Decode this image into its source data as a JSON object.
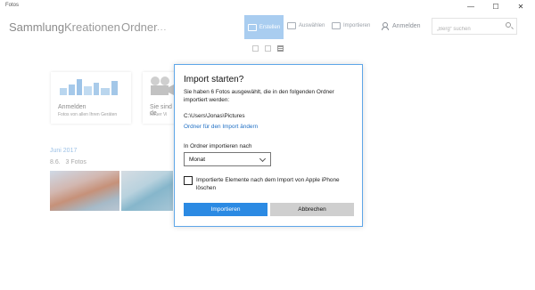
{
  "window": {
    "title": "Fotos",
    "min_glyph": "—",
    "max_glyph": "☐",
    "close_glyph": "✕"
  },
  "nav": {
    "tabs": [
      "Sammlung",
      "Kreationen",
      "Ordner"
    ],
    "more": "..."
  },
  "toolbar": {
    "erstellen": "Erstellen",
    "auswaehlen": "Auswählen",
    "importieren": "Importieren",
    "anmelden": "Anmelden"
  },
  "search": {
    "placeholder": "„Berg“ suchen"
  },
  "cards": [
    {
      "title": "Anmelden",
      "subtitle": "Fotos von allen Ihren Geräten"
    },
    {
      "title": "Sie sind de",
      "subtitle": "Neuer Vi"
    }
  ],
  "timeline": {
    "month": "Juni 2017",
    "day": "8.6.",
    "count": "3 Fotos"
  },
  "dialog": {
    "title": "Import starten?",
    "message": "Sie haben 6 Fotos ausgewählt, die in den folgenden Ordner importiert werden:",
    "path": "C:\\Users\\Jonas\\Pictures",
    "change_folder_link": "Ordner für den Import ändern",
    "import_into_label": "In Ordner importieren nach",
    "select_value": "Monat",
    "delete_checkbox_label": "Importierte Elemente nach dem Import von Apple iPhone löschen",
    "import_button": "Importieren",
    "cancel_button": "Abbrechen"
  },
  "colors": {
    "accent": "#2b8ae3",
    "link": "#1f6fc4",
    "toolbar_active": "#a9cdf0",
    "dialog_border": "#5ea6e8"
  }
}
